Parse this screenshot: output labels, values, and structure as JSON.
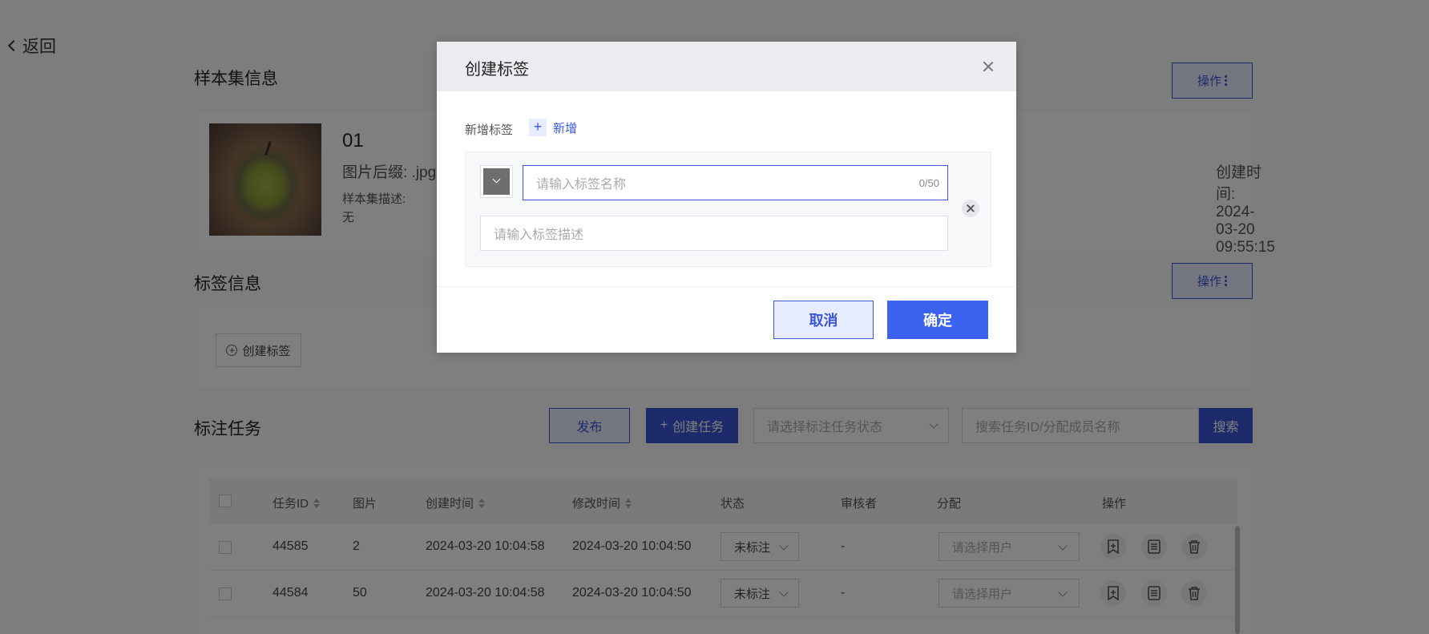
{
  "nav": {
    "back_label": "返回"
  },
  "sample_section": {
    "title": "样本集信息",
    "op_label": "操作",
    "name": "01",
    "suffix": "图片后缀: .jpg",
    "desc_label": "样本集描述:",
    "desc_value": "无",
    "created": "创建时间: 2024-03-20 09:55:15"
  },
  "tag_section": {
    "title": "标签信息",
    "op_label": "操作",
    "create_label": "创建标签"
  },
  "task_section": {
    "title": "标注任务",
    "publish_label": "发布",
    "create_task_label": "创建任务",
    "status_placeholder": "请选择标注任务状态",
    "search_placeholder": "搜索任务ID/分配成员名称",
    "search_label": "搜索"
  },
  "table": {
    "headers": {
      "id": "任务ID",
      "images": "图片",
      "created": "创建时间",
      "modified": "修改时间",
      "status": "状态",
      "reviewer": "审核者",
      "assign": "分配",
      "actions": "操作"
    },
    "rows": [
      {
        "id": "44585",
        "images": "2",
        "created": "2024-03-20 10:04:58",
        "modified": "2024-03-20 10:04:50",
        "status": "未标注",
        "reviewer": "-",
        "assign_placeholder": "请选择用户"
      },
      {
        "id": "44584",
        "images": "50",
        "created": "2024-03-20 10:04:58",
        "modified": "2024-03-20 10:04:50",
        "status": "未标注",
        "reviewer": "-",
        "assign_placeholder": "请选择用户"
      }
    ]
  },
  "modal": {
    "title": "创建标签",
    "add_row_label": "新增标签",
    "add_label": "新增",
    "name_placeholder": "请输入标签名称",
    "name_count": "0/50",
    "desc_placeholder": "请输入标签描述",
    "cancel_label": "取消",
    "ok_label": "确定",
    "swatch_color": "#6e6e6e"
  },
  "colors": {
    "primary": "#3b56d9",
    "primary_light": "#e8ecff",
    "overlay": "rgba(0,0,0,0.5)"
  }
}
